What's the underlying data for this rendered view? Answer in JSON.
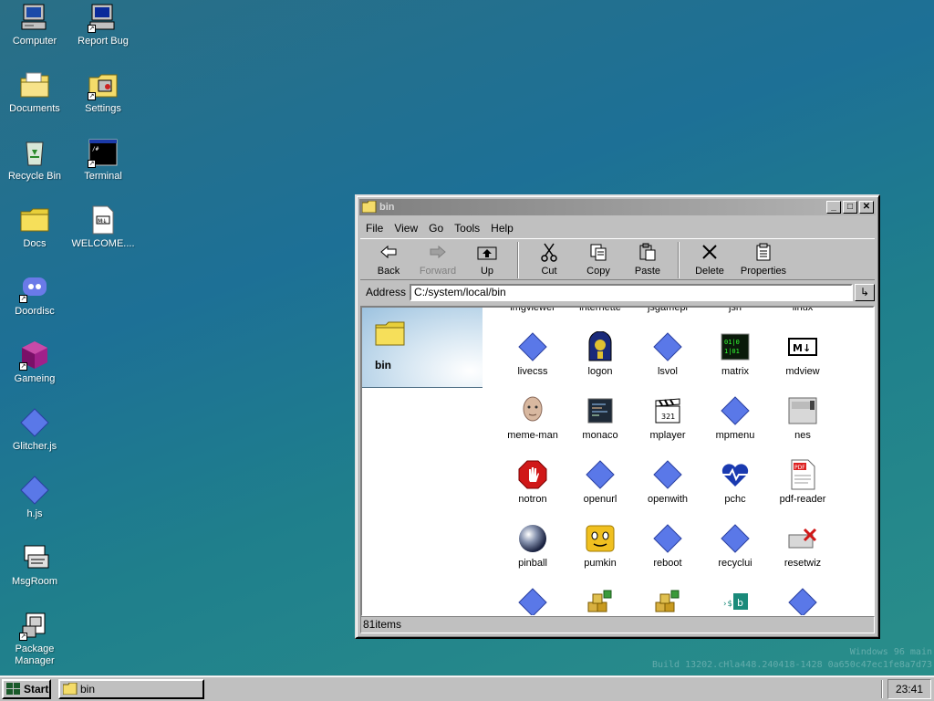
{
  "desktop": {
    "icons": [
      {
        "label": "Computer",
        "icon": "computer-icon"
      },
      {
        "label": "Report Bug",
        "icon": "report-bug-icon"
      },
      {
        "label": "Documents",
        "icon": "documents-folder-icon"
      },
      {
        "label": "Settings",
        "icon": "settings-icon"
      },
      {
        "label": "Recycle Bin",
        "icon": "recycle-bin-icon"
      },
      {
        "label": "Terminal",
        "icon": "terminal-icon"
      },
      {
        "label": "Docs",
        "icon": "folder-icon"
      },
      {
        "label": "WELCOME....",
        "icon": "markdown-file-icon"
      },
      {
        "label": "Doordisc",
        "icon": "doordisc-icon"
      },
      {
        "label": "Gameing",
        "icon": "cube-icon"
      },
      {
        "label": "Glitcher.js",
        "icon": "diamond-icon"
      },
      {
        "label": "h.js",
        "icon": "diamond-icon"
      },
      {
        "label": "MsgRoom",
        "icon": "msgroom-icon"
      },
      {
        "label": "Package Manager",
        "icon": "package-manager-icon"
      }
    ],
    "watermark_line1": "Windows 96 main",
    "watermark_line2": "Build 13202.cHla448.240418-1428 0a650c47ec1fe8a7d73"
  },
  "window": {
    "title": "bin",
    "menu": [
      "File",
      "View",
      "Go",
      "Tools",
      "Help"
    ],
    "toolbar": {
      "back": "Back",
      "forward": "Forward",
      "up": "Up",
      "cut": "Cut",
      "copy": "Copy",
      "paste": "Paste",
      "delete": "Delete",
      "properties": "Properties"
    },
    "address_label": "Address",
    "address_value": "C:/system/local/bin",
    "folder_name": "bin",
    "partial_row": [
      "imgviewer",
      "internette",
      "jsgamepl",
      "jsh",
      "linux"
    ],
    "files": [
      {
        "name": "livecss",
        "icon": "diamond-icon"
      },
      {
        "name": "logon",
        "icon": "logon-icon"
      },
      {
        "name": "lsvol",
        "icon": "diamond-icon"
      },
      {
        "name": "matrix",
        "icon": "matrix-icon"
      },
      {
        "name": "mdview",
        "icon": "markdown-icon"
      },
      {
        "name": "meme-man",
        "icon": "meme-man-icon"
      },
      {
        "name": "monaco",
        "icon": "monaco-icon"
      },
      {
        "name": "mplayer",
        "icon": "clapperboard-icon"
      },
      {
        "name": "mpmenu",
        "icon": "diamond-icon"
      },
      {
        "name": "nes",
        "icon": "nes-icon"
      },
      {
        "name": "notron",
        "icon": "stop-hand-icon"
      },
      {
        "name": "openurl",
        "icon": "diamond-icon"
      },
      {
        "name": "openwith",
        "icon": "diamond-icon"
      },
      {
        "name": "pchc",
        "icon": "heart-pulse-icon"
      },
      {
        "name": "pdf-reader",
        "icon": "pdf-icon"
      },
      {
        "name": "pinball",
        "icon": "pinball-icon"
      },
      {
        "name": "pumkin",
        "icon": "pumkin-icon"
      },
      {
        "name": "reboot",
        "icon": "diamond-icon"
      },
      {
        "name": "recyclui",
        "icon": "diamond-icon"
      },
      {
        "name": "resetwiz",
        "icon": "resetwiz-icon"
      }
    ],
    "status": "81items"
  },
  "taskbar": {
    "start_label": "Start",
    "task_label": "bin",
    "clock": "23:41"
  },
  "colors": {
    "diamond": "#5a78e8",
    "titlebar": "#8a8a8a",
    "desktop": "#1d7096"
  }
}
